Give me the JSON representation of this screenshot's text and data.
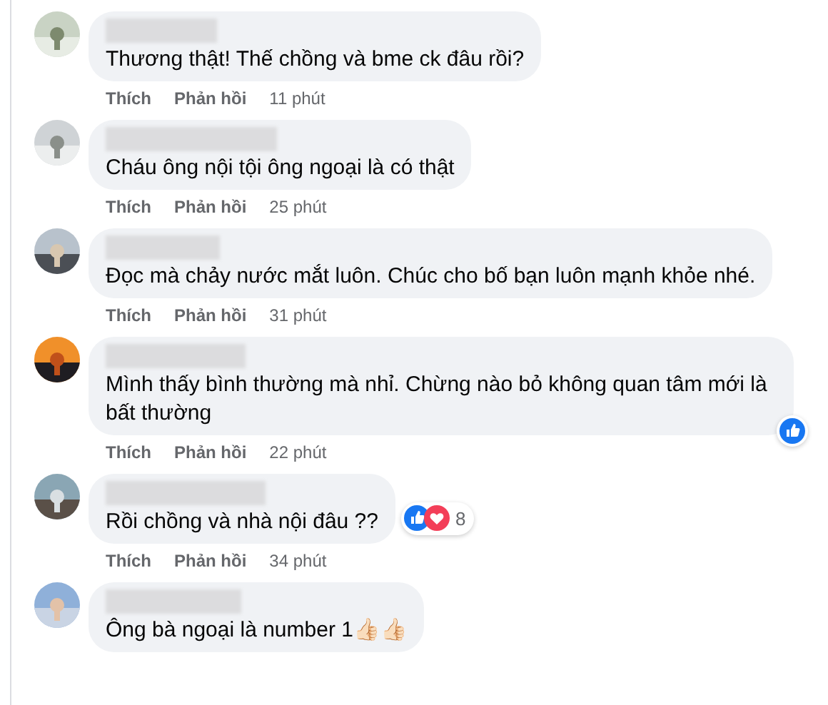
{
  "comments": [
    {
      "text": "Thương thật! Thế chồng và bme ck đâu rồi?",
      "actions": [
        "Thích",
        "Phản hồi"
      ],
      "time": "11 phút"
    },
    {
      "text": "Cháu ông nội tội ông ngoại là có thật",
      "actions": [
        "Thích",
        "Phản hồi"
      ],
      "time": "25 phút"
    },
    {
      "text": "Đọc mà chảy nước mắt luôn. Chúc cho bố bạn luôn mạnh khỏe nhé.",
      "actions": [
        "Thích",
        "Phản hồi"
      ],
      "time": "31 phút"
    },
    {
      "text": "Mình thấy bình thường mà nhỉ. Chừng nào bỏ không quan tâm mới là bất thường",
      "reactions": {
        "types": [
          {
            "kind": "like"
          }
        ]
      },
      "actions": [
        "Thích",
        "Phản hồi"
      ],
      "time": "22 phút"
    },
    {
      "text": "Rồi chồng và nhà nội đâu ??",
      "reactions": {
        "types": [
          {
            "kind": "like"
          },
          {
            "kind": "love"
          }
        ],
        "count": "8"
      },
      "actions": [
        "Thích",
        "Phản hồi"
      ],
      "time": "34 phút"
    },
    {
      "text": "Ông bà ngoại là number 1👍🏻👍🏻"
    }
  ]
}
